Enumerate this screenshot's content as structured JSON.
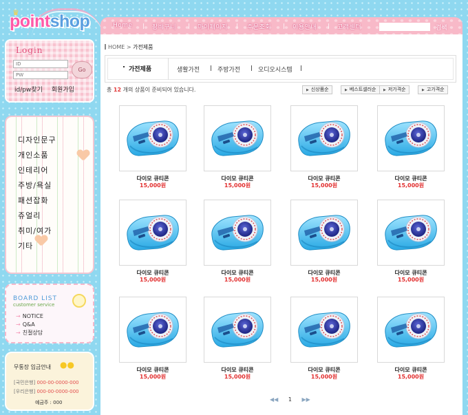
{
  "logo": {
    "text_part1": "point",
    "text_part2": "shop"
  },
  "login": {
    "title": "Login",
    "id_placeholder": "ID",
    "pw_placeholder": "PW",
    "go_label": "Go",
    "find_label": "id/pw찾기",
    "join_label": "회원가입"
  },
  "categories": [
    "디자인문구",
    "개인소품",
    "인테리어",
    "주방/욕실",
    "패션잡화",
    "쥬얼리",
    "취미/여가",
    "기타"
  ],
  "board": {
    "title": "BOARD LIST",
    "subtitle": "customer service",
    "items": [
      "NOTICE",
      "Q&A",
      "친절상담"
    ]
  },
  "bank": {
    "title": "무통장 입금안내",
    "rows": [
      {
        "bank": "[국민은행]",
        "account": "000-00-0000-000"
      },
      {
        "bank": "[우리은행]",
        "account": "000-00-0000-000"
      }
    ],
    "holder": "예금주 : 000"
  },
  "topmenu": {
    "items": [
      "Home",
      "장바구니",
      "마이페이지",
      "주문조회",
      "이용안내",
      "고객센터"
    ],
    "search_label": "검색"
  },
  "breadcrumb": {
    "home": "HOME",
    "current": "가전제품"
  },
  "tabs": {
    "active": "가전제품",
    "items": [
      "생활가전",
      "주방가전",
      "오디오시스템"
    ]
  },
  "summary": {
    "prefix": "총",
    "count": "12",
    "suffix": "개의 상품이 준비되어 있습니다."
  },
  "sort_buttons": [
    "신상품순",
    "베스트셀러순",
    "저가격순",
    "고가격순"
  ],
  "products": [
    {
      "name": "다이모 큐티콘",
      "price": "15,000원"
    },
    {
      "name": "다이모 큐티콘",
      "price": "15,000원"
    },
    {
      "name": "다이모 큐티콘",
      "price": "15,000원"
    },
    {
      "name": "다이모 큐티콘",
      "price": "15,000원"
    },
    {
      "name": "다이모 큐티콘",
      "price": "15,000원"
    },
    {
      "name": "다이모 큐티콘",
      "price": "15,000원"
    },
    {
      "name": "다이모 큐티콘",
      "price": "15,000원"
    },
    {
      "name": "다이모 큐티콘",
      "price": "15,000원"
    },
    {
      "name": "다이모 큐티콘",
      "price": "15,000원"
    },
    {
      "name": "다이모 큐티콘",
      "price": "15,000원"
    },
    {
      "name": "다이모 큐티콘",
      "price": "15,000원"
    },
    {
      "name": "다이모 큐티콘",
      "price": "15,000원"
    }
  ],
  "pager": {
    "prev": "◀◀",
    "page": "1",
    "next": "▶▶"
  },
  "colors": {
    "accent_pink": "#f8b9c8",
    "price_red": "#e23030",
    "background_blue": "#8fd8f0"
  }
}
